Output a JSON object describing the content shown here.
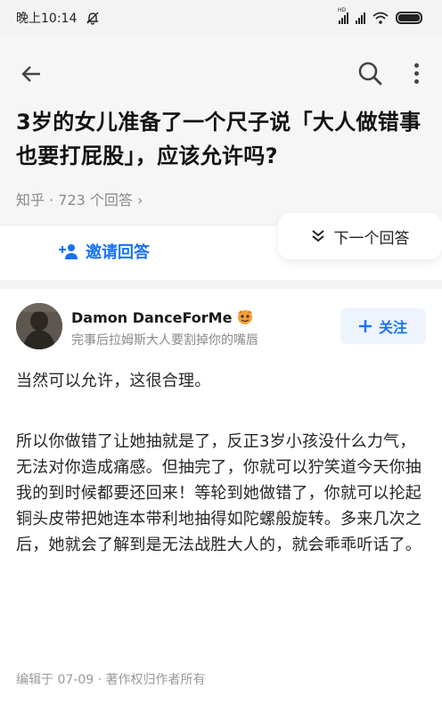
{
  "status_bar": {
    "time": "晚上10:14",
    "signal_label": "HD",
    "colors": {
      "background": "#f3f3f3"
    }
  },
  "question": {
    "title": "3岁的女儿准备了一个尺子说「大人做错事也要打屁股」，应该允许吗?",
    "meta": "知乎 · 723 个回答 ›"
  },
  "actions": {
    "invite_label": "邀请回答",
    "next_label": "下一个回答"
  },
  "author": {
    "name": "Damon DanceForMe",
    "bio": "完事后拉姆斯大人要割掉你的嘴唇",
    "follow_label": "关注"
  },
  "answer": {
    "paragraphs": [
      "当然可以允许，这很合理。",
      "所以你做错了让她抽就是了，反正3岁小孩没什么力气，无法对你造成痛感。但抽完了，你就可以狞笑道今天你抽我的到时候都要还回来！等轮到她做错了，你就可以抡起铜头皮带把她连本带利地抽得如陀螺般旋转。多来几次之后，她就会了解到是无法战胜大人的，就会乖乖听话了。"
    ],
    "footer": "编辑于 07-09 · 著作权归作者所有"
  },
  "colors": {
    "accent": "#1772f6",
    "follow_bg": "#eef4fe",
    "meta_text": "#8a8a8a"
  },
  "icons": [
    "back-arrow-icon",
    "search-icon",
    "more-vertical-icon",
    "invite-user-icon",
    "double-chevron-down-icon",
    "plus-icon",
    "mute-bell-icon",
    "signal-icon",
    "wifi-icon",
    "battery-icon"
  ]
}
